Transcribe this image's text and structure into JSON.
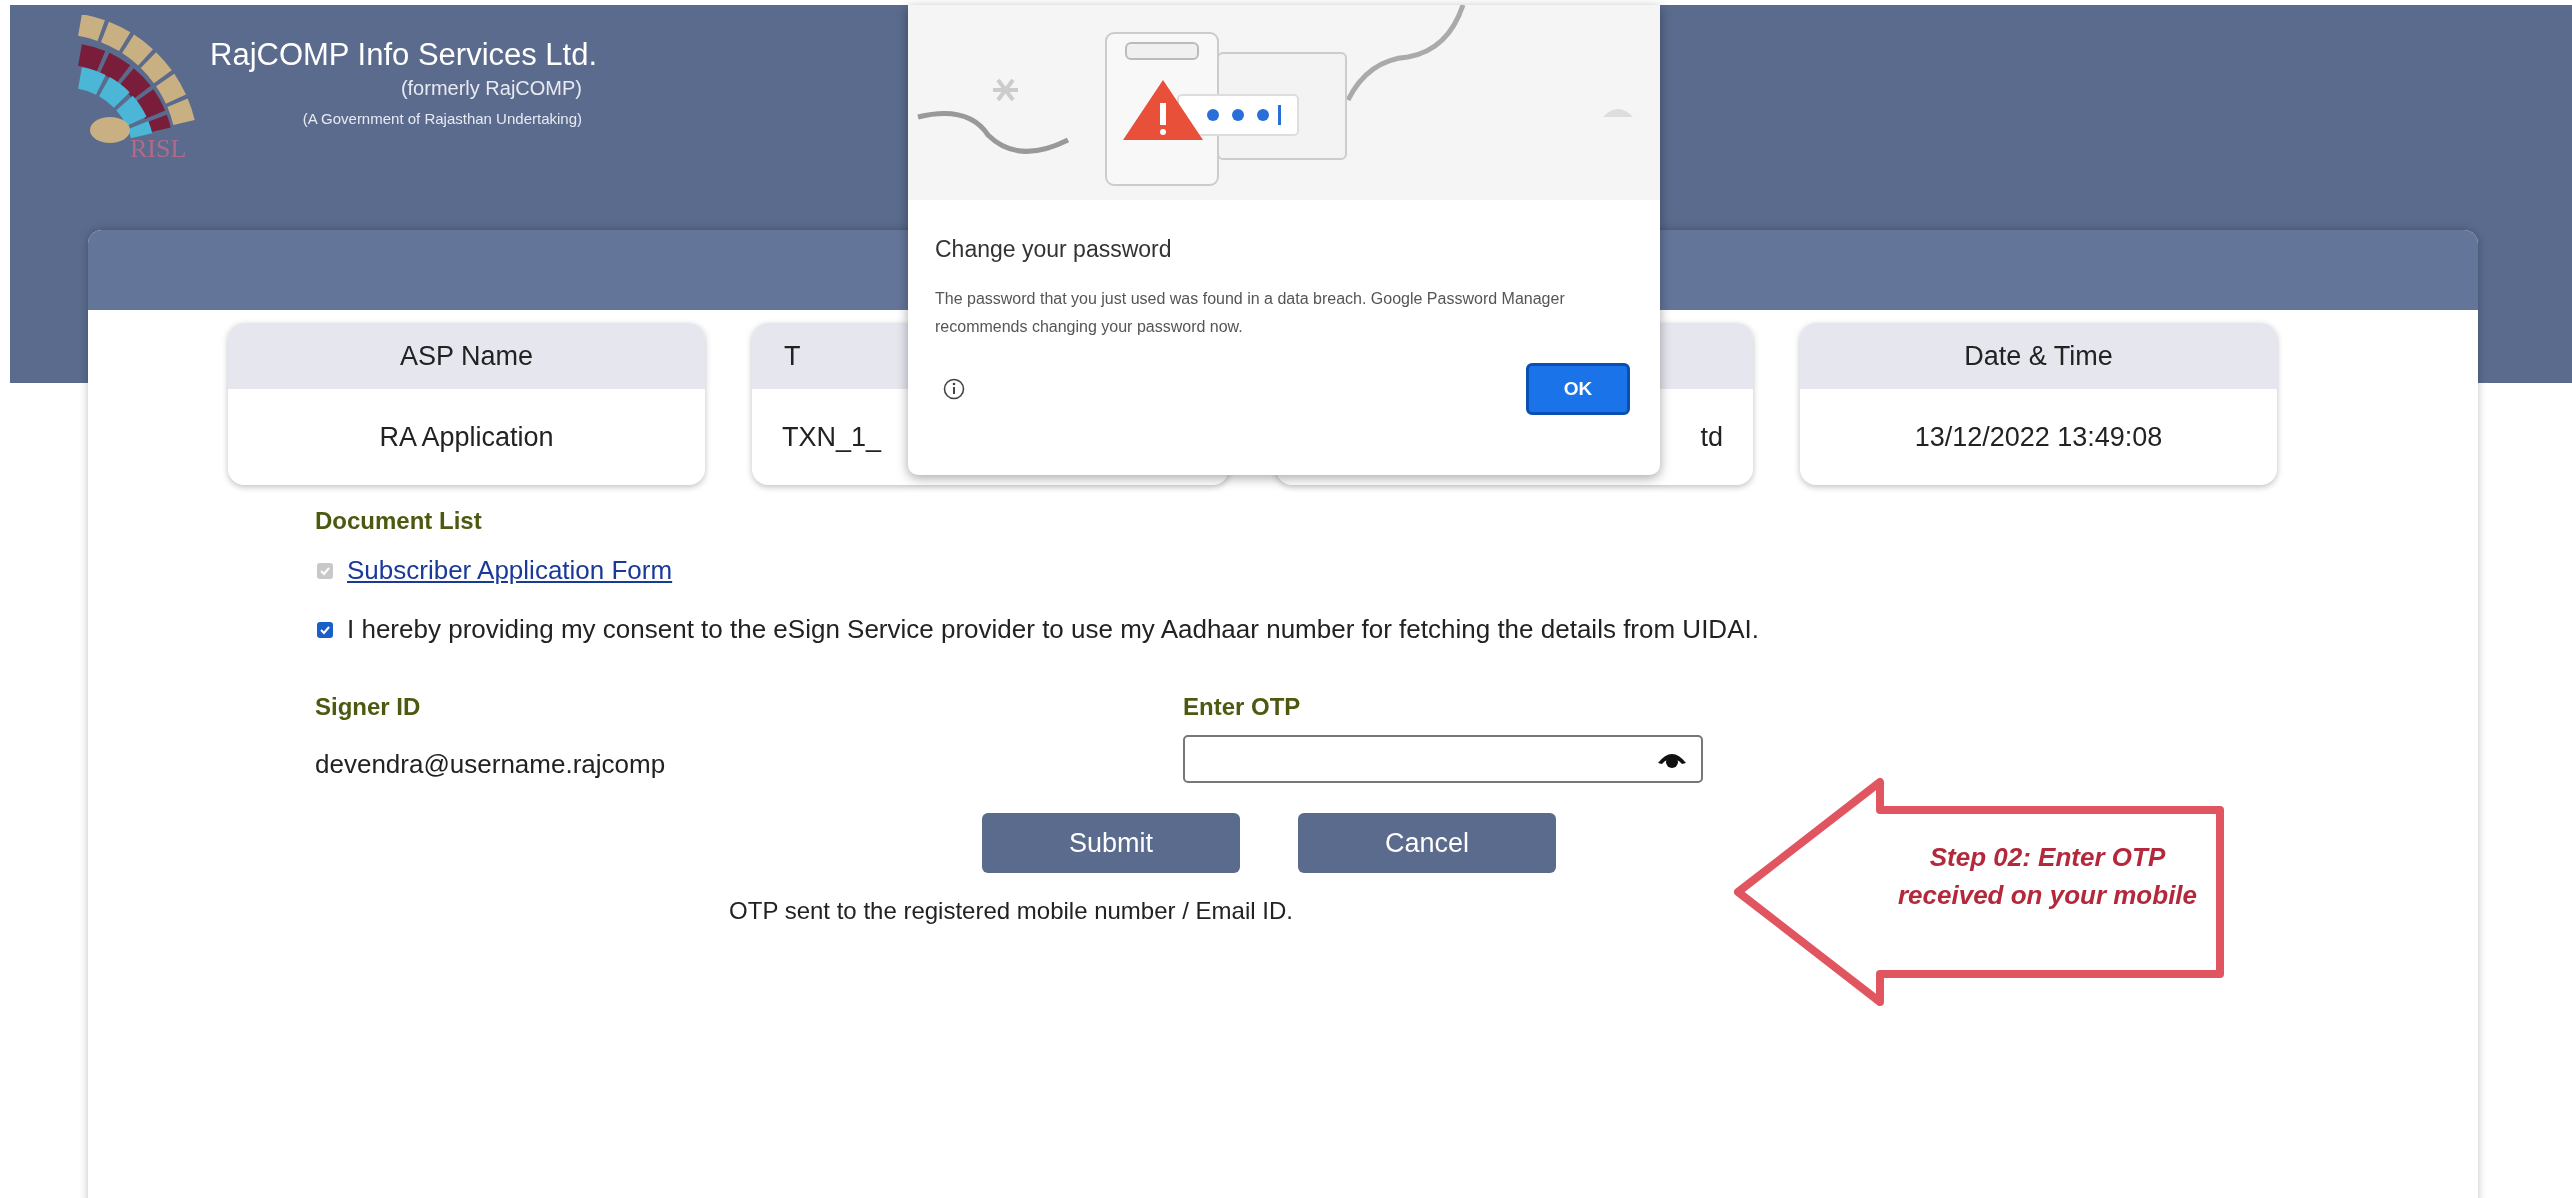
{
  "header": {
    "logo_text": "RISL",
    "company": "RajCOMP Info Services Ltd.",
    "former_name": "(formerly RajCOMP)",
    "tagline": "(A Government of Rajasthan Undertaking)"
  },
  "info_cards": [
    {
      "kind": "full",
      "label": "ASP Name",
      "value": "RA Application"
    },
    {
      "kind": "cut_right",
      "label": "T",
      "value": "TXN_1_"
    },
    {
      "kind": "cut_left",
      "value": "td"
    },
    {
      "kind": "full",
      "label": "Date & Time",
      "value": "13/12/2022 13:49:08"
    }
  ],
  "document_list": {
    "title": "Document List",
    "documents": [
      {
        "name": "Subscriber Application Form",
        "checked": true,
        "disabled": true
      }
    ]
  },
  "consent": {
    "text": "I hereby providing my consent to the eSign Service provider to use my Aadhaar number for fetching the details from UIDAI.",
    "checked": true,
    "disabled": false
  },
  "signer": {
    "label": "Signer ID",
    "value": "devendra@username.rajcomp"
  },
  "otp": {
    "label": "Enter OTP"
  },
  "buttons": [
    "Submit",
    "Cancel"
  ],
  "note": "OTP sent to the registered mobile number / Email ID.",
  "callout": {
    "text": "Step 02: Enter OTP received on your mobile"
  },
  "dialog": {
    "title": "Change your password",
    "message": "The password that you just used was found in a data breach. Google Password Manager recommends changing your password now.",
    "button": "OK"
  }
}
